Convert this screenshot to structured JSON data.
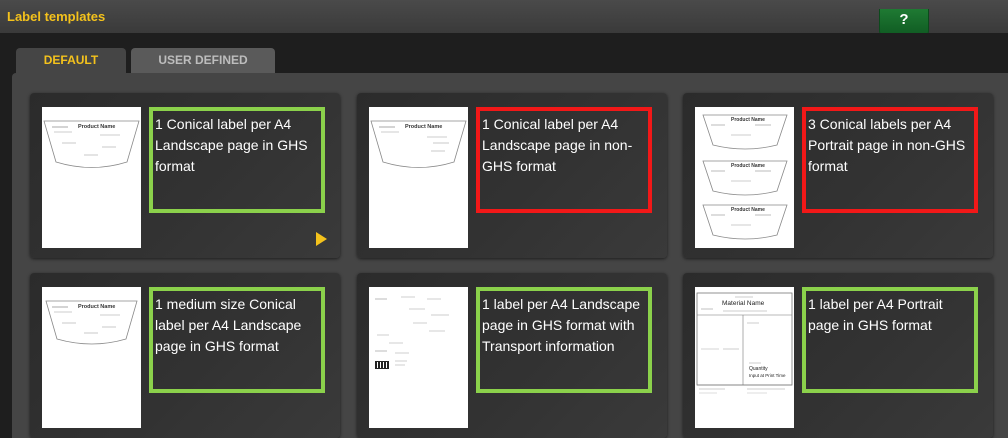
{
  "window": {
    "title": "Label templates",
    "help_label": "?"
  },
  "tabs": [
    {
      "label": "DEFAULT",
      "active": true
    },
    {
      "label": "USER DEFINED",
      "active": false
    }
  ],
  "colors": {
    "accent": "#f4c21c",
    "ghs_border": "#8bd14b",
    "non_ghs_border": "#f21818"
  },
  "templates": [
    {
      "description": "1 Conical label per A4 Landscape page in GHS format",
      "thumb_title": "Product Name",
      "border": "green"
    },
    {
      "description": "1 Conical label per A4 Landscape page in non-GHS format",
      "thumb_title": "Product Name",
      "border": "red"
    },
    {
      "description": "3 Conical labels per A4 Portrait page in non-GHS format",
      "thumb_title": "Product Name",
      "border": "red"
    },
    {
      "description": "1 medium size Conical label per A4 Landscape page in GHS format",
      "thumb_title": "Product Name",
      "border": "green"
    },
    {
      "description": "1 label per A4 Landscape page in GHS format with Transport information",
      "border": "green"
    },
    {
      "description": "1 label per A4 Portrait page in GHS format",
      "thumb_title": "Material Name",
      "thumb_lines": [
        "Quantity",
        "Input at Print Time"
      ],
      "border": "green"
    }
  ]
}
